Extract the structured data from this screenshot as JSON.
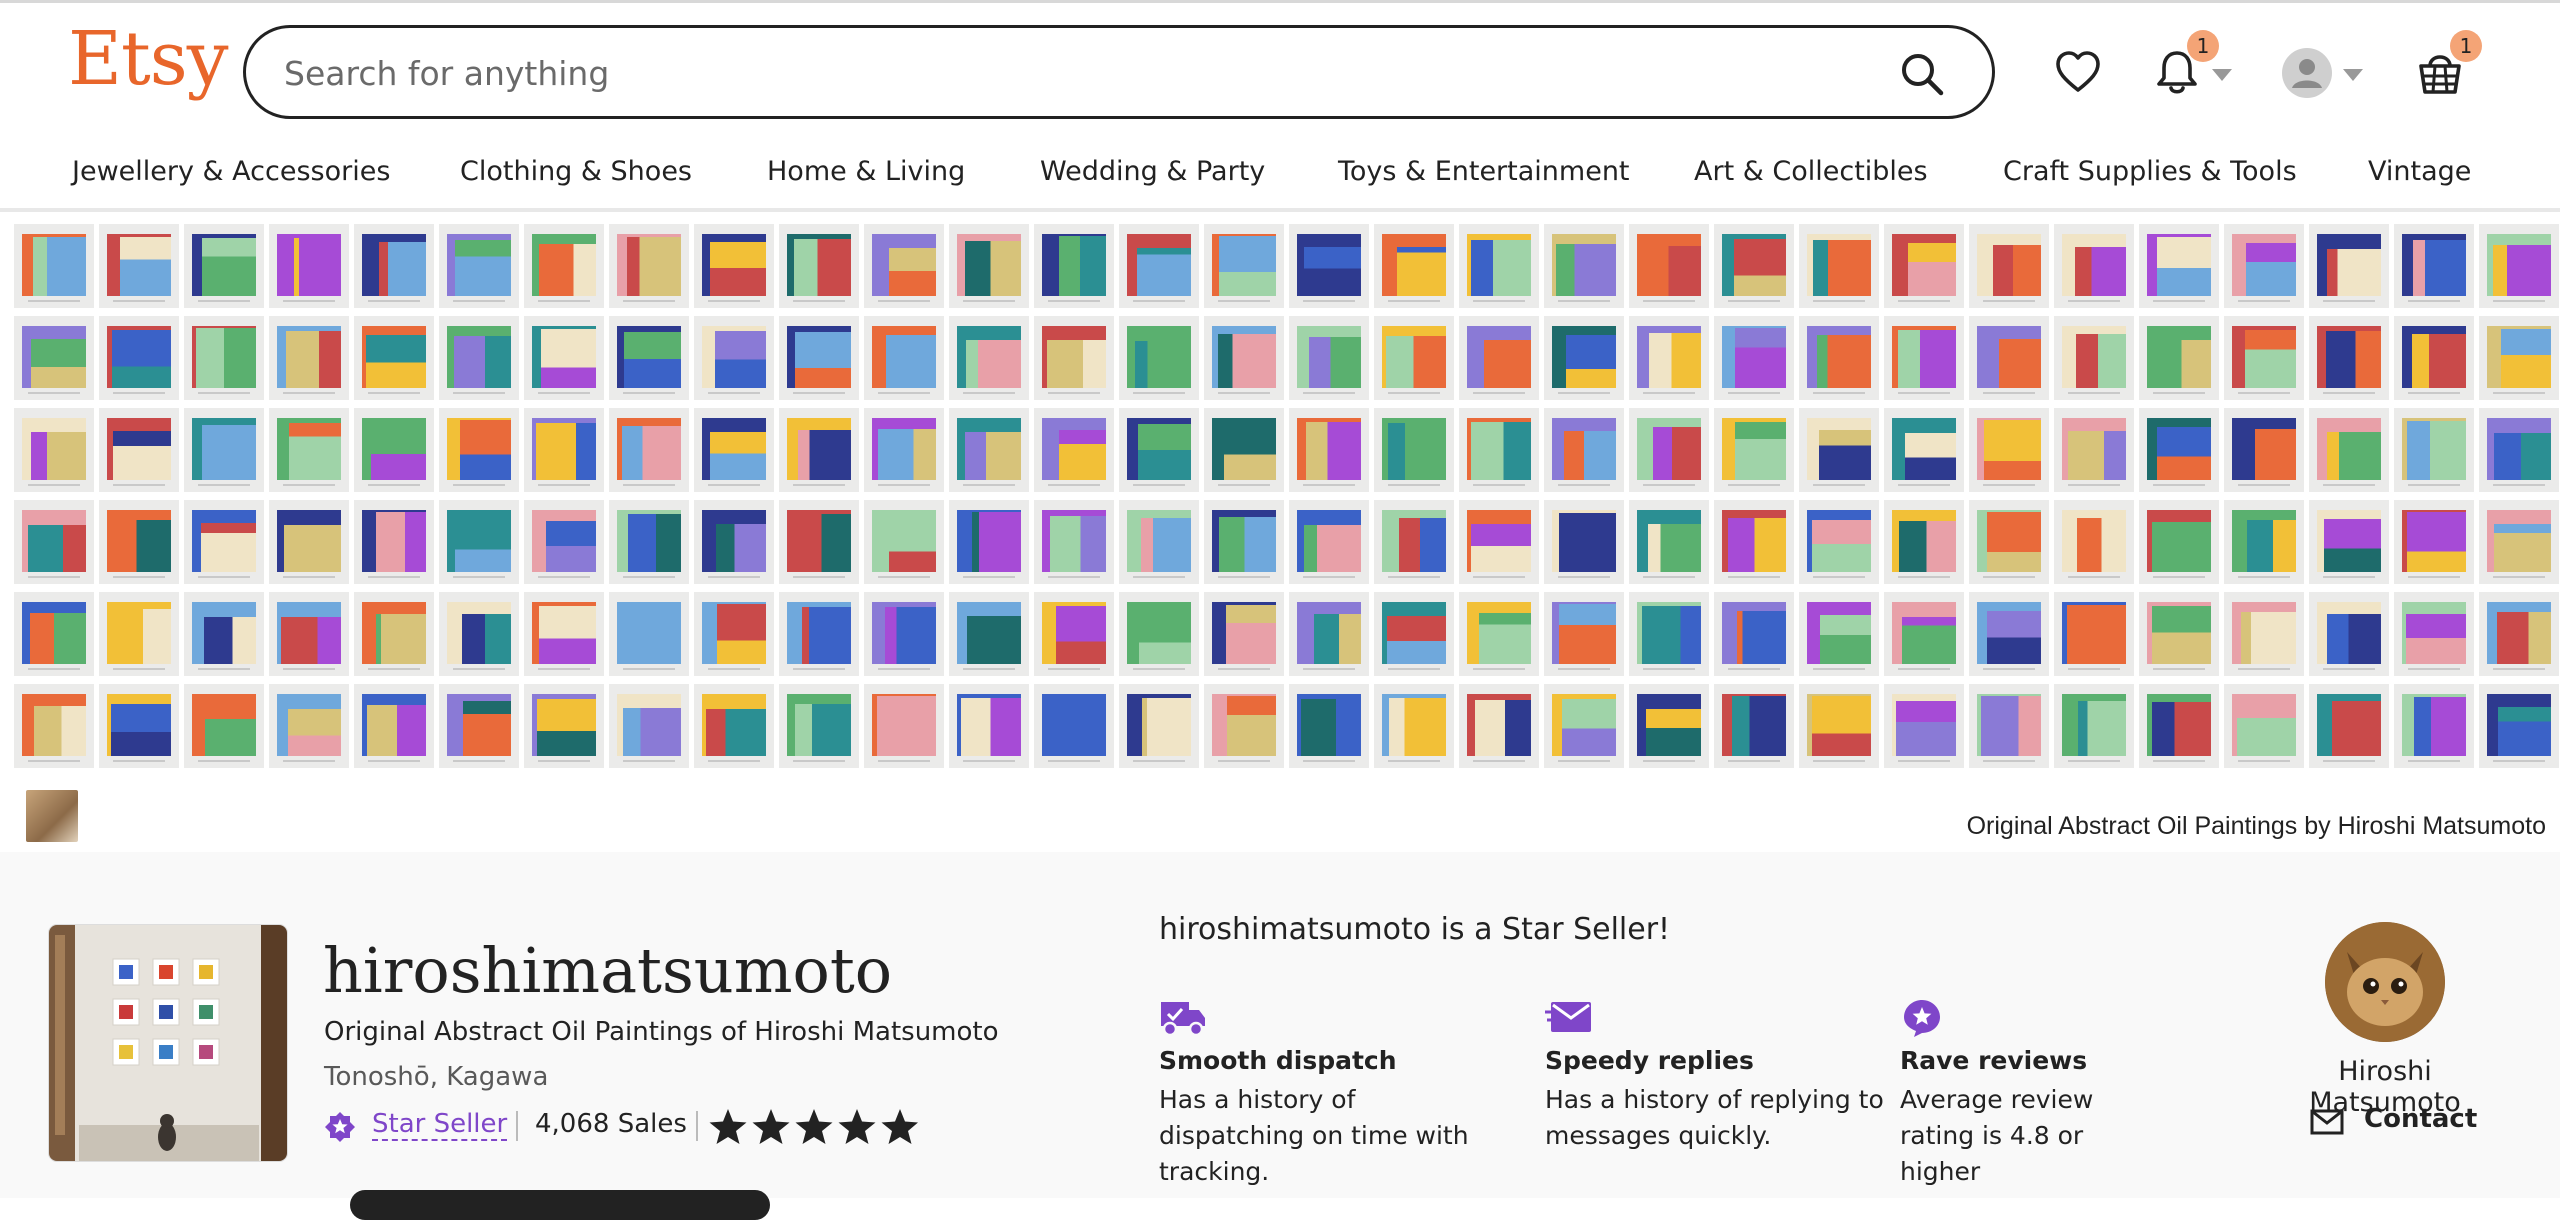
{
  "header": {
    "logo": "Etsy",
    "search_placeholder": "Search for anything",
    "notifications_count": "1",
    "cart_count": "1"
  },
  "categories": [
    "Jewellery & Accessories",
    "Clothing & Shoes",
    "Home & Living",
    "Wedding & Party",
    "Toys & Entertainment",
    "Art & Collectibles",
    "Craft Supplies & Tools",
    "Vintage"
  ],
  "banner": {
    "caption": "Original Abstract Oil Paintings by Hiroshi Matsumoto"
  },
  "shop": {
    "name": "hiroshimatsumoto",
    "tagline": "Original Abstract Oil Paintings of Hiroshi Matsumoto",
    "location": "Tonoshō, Kagawa",
    "star_seller_label": "Star Seller",
    "sales": "4,068 Sales",
    "rating_stars": 5
  },
  "star_seller": {
    "headline": "hiroshimatsumoto is a Star Seller!",
    "features": [
      {
        "icon": "truck-icon",
        "title": "Smooth dispatch",
        "desc": "Has a history of dispatching on time with tracking."
      },
      {
        "icon": "envelope-icon",
        "title": "Speedy replies",
        "desc": "Has a history of replying to messages quickly."
      },
      {
        "icon": "star-badge-icon",
        "title": "Rave reviews",
        "desc": "Average review rating is 4.8 or higher"
      }
    ]
  },
  "owner": {
    "name": "Hiroshi Matsumoto",
    "contact_label": "Contact"
  },
  "colors": {
    "brand": "#e8662b",
    "star_seller": "#7f46c9",
    "badge": "#f4a476"
  }
}
